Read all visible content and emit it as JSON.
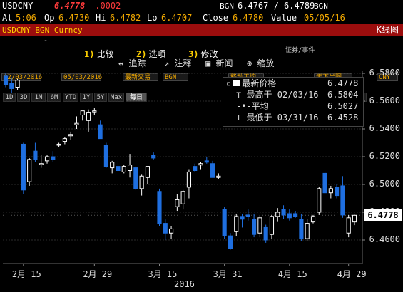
{
  "quote": {
    "ticker": "USDCNY",
    "last": "6.4778",
    "change": "-.0002",
    "source": "BGN",
    "bid_ask": "6.4767 / 6.4789",
    "source2": "BGN",
    "time_label": "At",
    "time": "5:06",
    "open_label": "Op",
    "open": "6.4730",
    "high_label": "Hi",
    "high": "6.4782",
    "low_label": "Lo",
    "low": "6.4707",
    "close_label": "Close",
    "close": "6.4780",
    "value_label": "Value",
    "value_date": "05/05/16"
  },
  "toolbar": {
    "security": "USDCNY BGN Curncy",
    "tabs": [
      {
        "num": "1)",
        "label": "比较"
      },
      {
        "num": "2)",
        "label": "选项"
      },
      {
        "num": "3)",
        "label": "修改"
      }
    ],
    "chart_label": "K线图"
  },
  "controls": {
    "start_date": "02/03/2016",
    "end_date": "05/03/2016",
    "last_trade": "最新交易",
    "source": "BGN",
    "moving_avg": "移动平均",
    "no_events": "无下半图",
    "currency": "CNY",
    "sec_events": "证券/事件"
  },
  "periods": [
    "1D",
    "3D",
    "1M",
    "6M",
    "YTD",
    "1Y",
    "5Y",
    "Max",
    "每日"
  ],
  "active_period": "每日",
  "tools": [
    {
      "num": "↔",
      "label": "追踪"
    },
    {
      "num": "↗",
      "label": "注释"
    },
    {
      "num": "▣",
      "label": "新闻"
    },
    {
      "num": "⊕",
      "label": "缩放"
    }
  ],
  "legend": {
    "last_label": "最新价格",
    "last_value": "6.4778",
    "high_label": "最高于",
    "high_date": "02/03/16",
    "high_value": "6.5804",
    "avg_label": "平均",
    "avg_value": "6.5027",
    "low_label": "最低于",
    "low_date": "03/31/16",
    "low_value": "6.4528"
  },
  "price_tag": "6.4778",
  "year_label": "2016",
  "colors": {
    "up": "#ffffff",
    "down": "#1f6fe0",
    "grid": "#2a2a2a",
    "amber": "#f2a900",
    "toolbar_red": "#9b0d0d"
  },
  "chart_data": {
    "type": "candlestick",
    "ylim": [
      6.445,
      6.59
    ],
    "y_ticks": [
      "6.5800",
      "6.5600",
      "6.5400",
      "6.5200",
      "6.5000",
      "6.4800",
      "6.4600"
    ],
    "x_ticks": [
      "2月 15",
      "2月 29",
      "3月 15",
      "3月 31",
      "4月 15",
      "4月 29"
    ],
    "candles": [
      {
        "o": 6.578,
        "h": 6.5804,
        "l": 6.57,
        "c": 6.572
      },
      {
        "o": 6.573,
        "h": 6.577,
        "l": 6.566,
        "c": 6.569
      },
      {
        "o": 6.57,
        "h": 6.576,
        "l": 6.568,
        "c": 6.575
      },
      {
        "o": 6.529,
        "h": 6.53,
        "l": 6.493,
        "c": 6.496
      },
      {
        "o": 6.502,
        "h": 6.519,
        "l": 6.499,
        "c": 6.518
      },
      {
        "o": 6.524,
        "h": 6.53,
        "l": 6.516,
        "c": 6.518
      },
      {
        "o": 6.515,
        "h": 6.521,
        "l": 6.512,
        "c": 6.515
      },
      {
        "o": 6.517,
        "h": 6.521,
        "l": 6.515,
        "c": 6.52
      },
      {
        "o": 6.52,
        "h": 6.524,
        "l": 6.516,
        "c": 6.518
      },
      {
        "o": 6.5285,
        "h": 6.53,
        "l": 6.527,
        "c": 6.529
      },
      {
        "o": 6.531,
        "h": 6.534,
        "l": 6.529,
        "c": 6.533
      },
      {
        "o": 6.535,
        "h": 6.538,
        "l": 6.532,
        "c": 6.536
      },
      {
        "o": 6.543,
        "h": 6.549,
        "l": 6.54,
        "c": 6.544
      },
      {
        "o": 6.55,
        "h": 6.553,
        "l": 6.546,
        "c": 6.553
      },
      {
        "o": 6.546,
        "h": 6.554,
        "l": 6.538,
        "c": 6.552
      },
      {
        "o": 6.553,
        "h": 6.555,
        "l": 6.55,
        "c": 6.553
      },
      {
        "o": 6.543,
        "h": 6.546,
        "l": 6.538,
        "c": 6.533
      },
      {
        "o": 6.528,
        "h": 6.53,
        "l": 6.512,
        "c": 6.513
      },
      {
        "o": 6.512,
        "h": 6.517,
        "l": 6.508,
        "c": 6.516
      },
      {
        "o": 6.513,
        "h": 6.518,
        "l": 6.509,
        "c": 6.51
      },
      {
        "o": 6.509,
        "h": 6.514,
        "l": 6.508,
        "c": 6.513
      },
      {
        "o": 6.51,
        "h": 6.522,
        "l": 6.505,
        "c": 6.514
      },
      {
        "o": 6.512,
        "h": 6.513,
        "l": 6.496,
        "c": 6.497
      },
      {
        "o": 6.497,
        "h": 6.507,
        "l": 6.492,
        "c": 6.506
      },
      {
        "o": 6.505,
        "h": 6.513,
        "l": 6.5,
        "c": 6.513
      },
      {
        "o": 6.521,
        "h": 6.523,
        "l": 6.518,
        "c": 6.519
      },
      {
        "o": 6.495,
        "h": 6.497,
        "l": 6.47,
        "c": 6.472
      },
      {
        "o": 6.472,
        "h": 6.475,
        "l": 6.46,
        "c": 6.465
      },
      {
        "o": 6.465,
        "h": 6.47,
        "l": 6.461,
        "c": 6.468
      },
      {
        "o": 6.484,
        "h": 6.493,
        "l": 6.481,
        "c": 6.489
      },
      {
        "o": 6.486,
        "h": 6.496,
        "l": 6.482,
        "c": 6.495
      },
      {
        "o": 6.498,
        "h": 6.511,
        "l": 6.49,
        "c": 6.509
      },
      {
        "o": 6.513,
        "h": 6.515,
        "l": 6.509,
        "c": 6.51
      },
      {
        "o": 6.514,
        "h": 6.516,
        "l": 6.511,
        "c": 6.515
      },
      {
        "o": 6.517,
        "h": 6.52,
        "l": 6.515,
        "c": 6.516
      },
      {
        "o": 6.515,
        "h": 6.517,
        "l": 6.505,
        "c": 6.505
      },
      {
        "o": 6.505,
        "h": 6.508,
        "l": 6.504,
        "c": 6.506
      },
      {
        "o": 6.482,
        "h": 6.484,
        "l": 6.461,
        "c": 6.463
      },
      {
        "o": 6.463,
        "h": 6.465,
        "l": 6.453,
        "c": 6.454
      },
      {
        "o": 6.466,
        "h": 6.479,
        "l": 6.463,
        "c": 6.477
      },
      {
        "o": 6.477,
        "h": 6.479,
        "l": 6.469,
        "c": 6.475
      },
      {
        "o": 6.478,
        "h": 6.482,
        "l": 6.474,
        "c": 6.477
      },
      {
        "o": 6.475,
        "h": 6.479,
        "l": 6.462,
        "c": 6.464
      },
      {
        "o": 6.465,
        "h": 6.478,
        "l": 6.462,
        "c": 6.476
      },
      {
        "o": 6.469,
        "h": 6.471,
        "l": 6.458,
        "c": 6.46
      },
      {
        "o": 6.464,
        "h": 6.478,
        "l": 6.461,
        "c": 6.477
      },
      {
        "o": 6.477,
        "h": 6.483,
        "l": 6.473,
        "c": 6.48
      },
      {
        "o": 6.482,
        "h": 6.485,
        "l": 6.475,
        "c": 6.478
      },
      {
        "o": 6.479,
        "h": 6.482,
        "l": 6.474,
        "c": 6.476
      },
      {
        "o": 6.479,
        "h": 6.481,
        "l": 6.476,
        "c": 6.477
      },
      {
        "o": 6.475,
        "h": 6.479,
        "l": 6.459,
        "c": 6.461
      },
      {
        "o": 6.461,
        "h": 6.475,
        "l": 6.459,
        "c": 6.472
      },
      {
        "o": 6.473,
        "h": 6.478,
        "l": 6.472,
        "c": 6.477
      },
      {
        "o": 6.48,
        "h": 6.498,
        "l": 6.478,
        "c": 6.497
      },
      {
        "o": 6.508,
        "h": 6.509,
        "l": 6.494,
        "c": 6.494
      },
      {
        "o": 6.494,
        "h": 6.499,
        "l": 6.49,
        "c": 6.497
      },
      {
        "o": 6.498,
        "h": 6.5,
        "l": 6.49,
        "c": 6.492
      },
      {
        "o": 6.499,
        "h": 6.506,
        "l": 6.476,
        "c": 6.478
      },
      {
        "o": 6.465,
        "h": 6.478,
        "l": 6.462,
        "c": 6.476
      },
      {
        "o": 6.473,
        "h": 6.4782,
        "l": 6.4707,
        "c": 6.4778
      }
    ]
  }
}
